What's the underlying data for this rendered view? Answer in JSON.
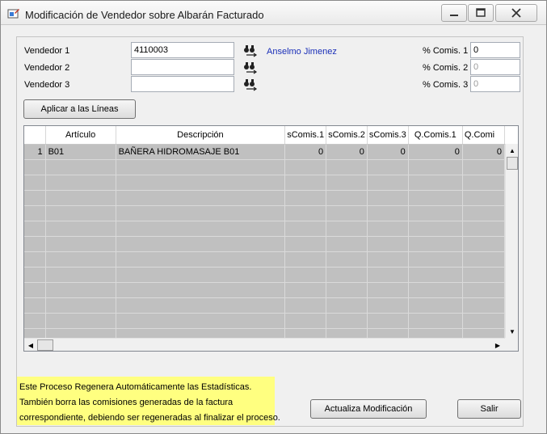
{
  "window": {
    "title": "Modificación de Vendedor sobre Albarán Facturado",
    "minimize_icon": "minimize-icon",
    "maximize_icon": "maximize-icon",
    "close_icon": "close-icon"
  },
  "vendors": [
    {
      "label": "Vendedor 1",
      "code": "4110003",
      "name": "Anselmo Jimenez",
      "commission_label": "% Comis. 1",
      "commission": "0"
    },
    {
      "label": "Vendedor 2",
      "code": "",
      "name": "",
      "commission_label": "% Comis. 2",
      "commission": "0"
    },
    {
      "label": "Vendedor 3",
      "code": "",
      "name": "",
      "commission_label": "% Comis. 3",
      "commission": "0"
    }
  ],
  "apply_button": "Aplicar a las Líneas",
  "grid": {
    "columns": [
      "",
      "Artículo",
      "Descripción",
      "sComis.1",
      "sComis.2",
      "sComis.3",
      "Q.Comis.1",
      "Q.Comi"
    ],
    "rows": [
      [
        "1",
        "B01",
        "BAÑERA HIDROMASAJE B01",
        "0",
        "0",
        "0",
        "0",
        "0"
      ]
    ]
  },
  "notice": {
    "line1": "Este Proceso Regenera Automáticamente las Estadísticas.",
    "line2": "También borra las comisiones generadas de la factura",
    "line3": "correspondiente, debiendo ser regeneradas al finalizar el proceso."
  },
  "buttons": {
    "update": "Actualiza Modificación",
    "exit": "Salir"
  },
  "colors": {
    "notice_bg": "#ffff80",
    "vendor_name": "#1a2fb8",
    "grid_row": "#c0c0c0"
  }
}
